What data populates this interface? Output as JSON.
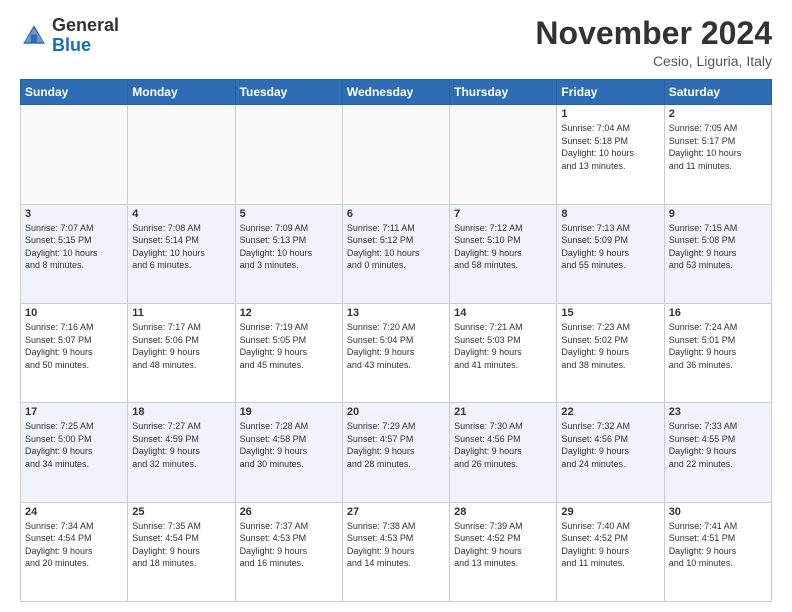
{
  "header": {
    "logo_line1": "General",
    "logo_line2": "Blue",
    "month_title": "November 2024",
    "location": "Cesio, Liguria, Italy"
  },
  "weekdays": [
    "Sunday",
    "Monday",
    "Tuesday",
    "Wednesday",
    "Thursday",
    "Friday",
    "Saturday"
  ],
  "weeks": [
    [
      {
        "day": "",
        "info": ""
      },
      {
        "day": "",
        "info": ""
      },
      {
        "day": "",
        "info": ""
      },
      {
        "day": "",
        "info": ""
      },
      {
        "day": "",
        "info": ""
      },
      {
        "day": "1",
        "info": "Sunrise: 7:04 AM\nSunset: 5:18 PM\nDaylight: 10 hours\nand 13 minutes."
      },
      {
        "day": "2",
        "info": "Sunrise: 7:05 AM\nSunset: 5:17 PM\nDaylight: 10 hours\nand 11 minutes."
      }
    ],
    [
      {
        "day": "3",
        "info": "Sunrise: 7:07 AM\nSunset: 5:15 PM\nDaylight: 10 hours\nand 8 minutes."
      },
      {
        "day": "4",
        "info": "Sunrise: 7:08 AM\nSunset: 5:14 PM\nDaylight: 10 hours\nand 6 minutes."
      },
      {
        "day": "5",
        "info": "Sunrise: 7:09 AM\nSunset: 5:13 PM\nDaylight: 10 hours\nand 3 minutes."
      },
      {
        "day": "6",
        "info": "Sunrise: 7:11 AM\nSunset: 5:12 PM\nDaylight: 10 hours\nand 0 minutes."
      },
      {
        "day": "7",
        "info": "Sunrise: 7:12 AM\nSunset: 5:10 PM\nDaylight: 9 hours\nand 58 minutes."
      },
      {
        "day": "8",
        "info": "Sunrise: 7:13 AM\nSunset: 5:09 PM\nDaylight: 9 hours\nand 55 minutes."
      },
      {
        "day": "9",
        "info": "Sunrise: 7:15 AM\nSunset: 5:08 PM\nDaylight: 9 hours\nand 53 minutes."
      }
    ],
    [
      {
        "day": "10",
        "info": "Sunrise: 7:16 AM\nSunset: 5:07 PM\nDaylight: 9 hours\nand 50 minutes."
      },
      {
        "day": "11",
        "info": "Sunrise: 7:17 AM\nSunset: 5:06 PM\nDaylight: 9 hours\nand 48 minutes."
      },
      {
        "day": "12",
        "info": "Sunrise: 7:19 AM\nSunset: 5:05 PM\nDaylight: 9 hours\nand 45 minutes."
      },
      {
        "day": "13",
        "info": "Sunrise: 7:20 AM\nSunset: 5:04 PM\nDaylight: 9 hours\nand 43 minutes."
      },
      {
        "day": "14",
        "info": "Sunrise: 7:21 AM\nSunset: 5:03 PM\nDaylight: 9 hours\nand 41 minutes."
      },
      {
        "day": "15",
        "info": "Sunrise: 7:23 AM\nSunset: 5:02 PM\nDaylight: 9 hours\nand 38 minutes."
      },
      {
        "day": "16",
        "info": "Sunrise: 7:24 AM\nSunset: 5:01 PM\nDaylight: 9 hours\nand 36 minutes."
      }
    ],
    [
      {
        "day": "17",
        "info": "Sunrise: 7:25 AM\nSunset: 5:00 PM\nDaylight: 9 hours\nand 34 minutes."
      },
      {
        "day": "18",
        "info": "Sunrise: 7:27 AM\nSunset: 4:59 PM\nDaylight: 9 hours\nand 32 minutes."
      },
      {
        "day": "19",
        "info": "Sunrise: 7:28 AM\nSunset: 4:58 PM\nDaylight: 9 hours\nand 30 minutes."
      },
      {
        "day": "20",
        "info": "Sunrise: 7:29 AM\nSunset: 4:57 PM\nDaylight: 9 hours\nand 28 minutes."
      },
      {
        "day": "21",
        "info": "Sunrise: 7:30 AM\nSunset: 4:56 PM\nDaylight: 9 hours\nand 26 minutes."
      },
      {
        "day": "22",
        "info": "Sunrise: 7:32 AM\nSunset: 4:56 PM\nDaylight: 9 hours\nand 24 minutes."
      },
      {
        "day": "23",
        "info": "Sunrise: 7:33 AM\nSunset: 4:55 PM\nDaylight: 9 hours\nand 22 minutes."
      }
    ],
    [
      {
        "day": "24",
        "info": "Sunrise: 7:34 AM\nSunset: 4:54 PM\nDaylight: 9 hours\nand 20 minutes."
      },
      {
        "day": "25",
        "info": "Sunrise: 7:35 AM\nSunset: 4:54 PM\nDaylight: 9 hours\nand 18 minutes."
      },
      {
        "day": "26",
        "info": "Sunrise: 7:37 AM\nSunset: 4:53 PM\nDaylight: 9 hours\nand 16 minutes."
      },
      {
        "day": "27",
        "info": "Sunrise: 7:38 AM\nSunset: 4:53 PM\nDaylight: 9 hours\nand 14 minutes."
      },
      {
        "day": "28",
        "info": "Sunrise: 7:39 AM\nSunset: 4:52 PM\nDaylight: 9 hours\nand 13 minutes."
      },
      {
        "day": "29",
        "info": "Sunrise: 7:40 AM\nSunset: 4:52 PM\nDaylight: 9 hours\nand 11 minutes."
      },
      {
        "day": "30",
        "info": "Sunrise: 7:41 AM\nSunset: 4:51 PM\nDaylight: 9 hours\nand 10 minutes."
      }
    ]
  ]
}
